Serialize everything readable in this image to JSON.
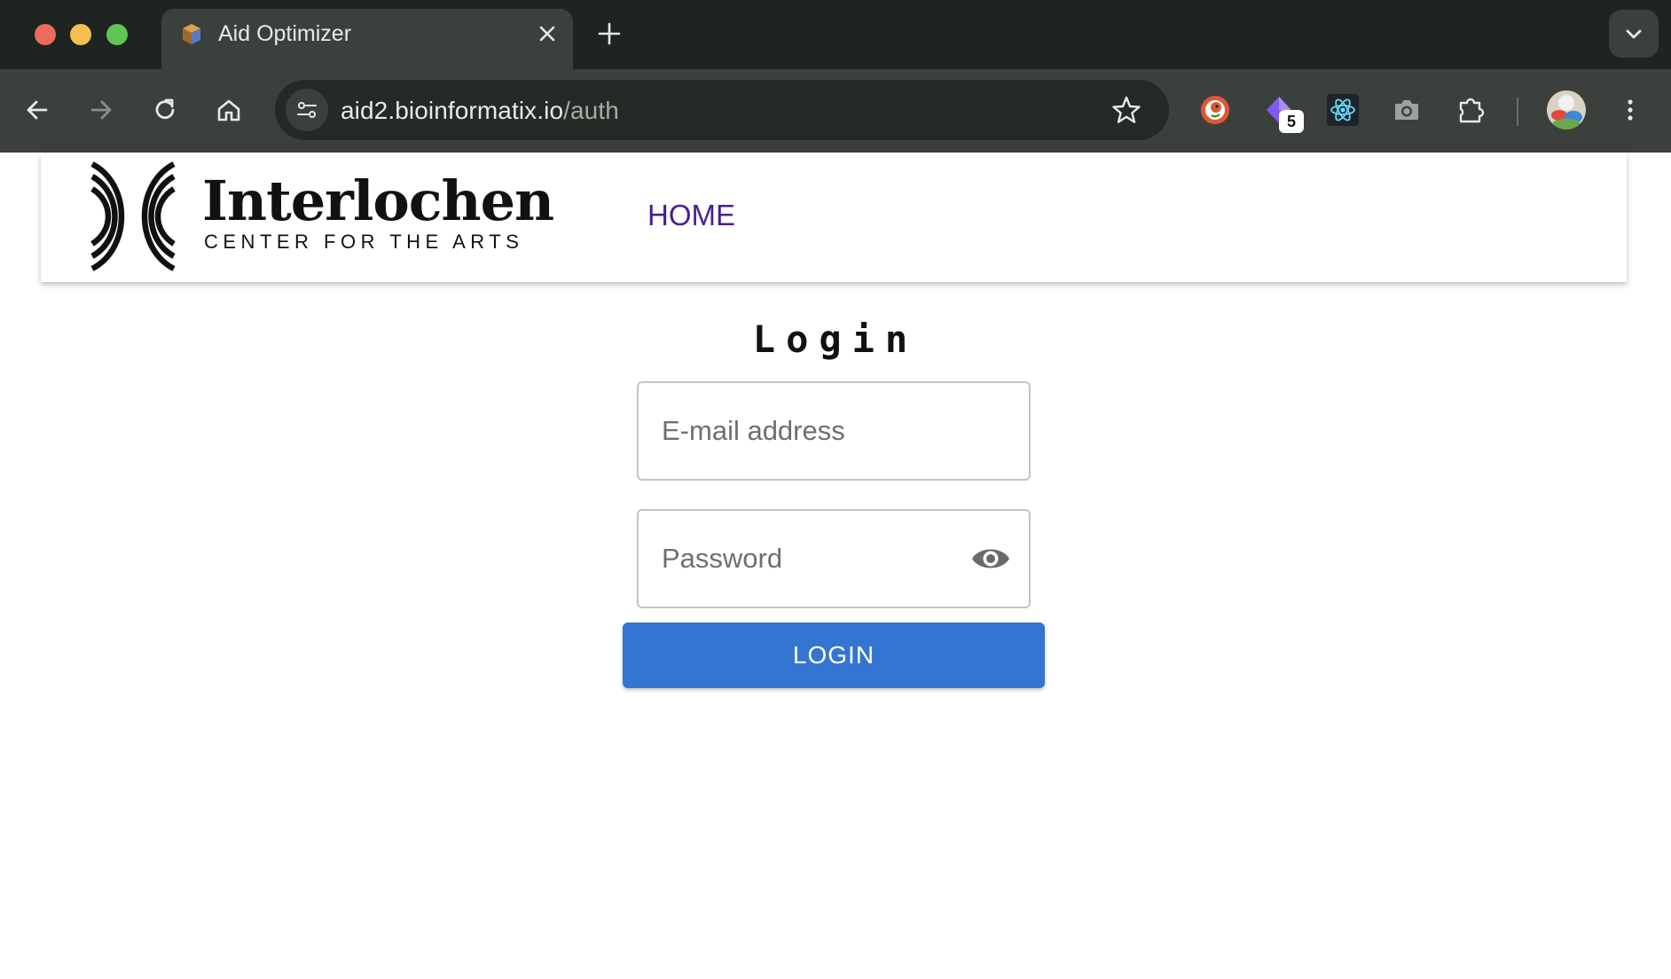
{
  "browser": {
    "tab": {
      "title": "Aid Optimizer"
    },
    "address": {
      "host": "aid2.bioinformatix.io",
      "path": "/auth"
    },
    "extensions": [
      {
        "name": "duckduckgo-icon"
      },
      {
        "name": "gem-icon",
        "badge": "5"
      },
      {
        "name": "react-icon"
      },
      {
        "name": "camera-icon"
      },
      {
        "name": "puzzle-icon"
      }
    ]
  },
  "header": {
    "logo_name": "Interlochen",
    "logo_subtitle": "CENTER FOR THE ARTS",
    "nav_home": "HOME"
  },
  "login": {
    "title": "Login",
    "email_placeholder": "E-mail address",
    "password_placeholder": "Password",
    "button_label": "LOGIN"
  },
  "colors": {
    "primary_button": "#3475d1",
    "nav_link": "#4a1f8c",
    "chrome_dark": "#1e2420",
    "chrome_toolbar": "#3c403c"
  }
}
